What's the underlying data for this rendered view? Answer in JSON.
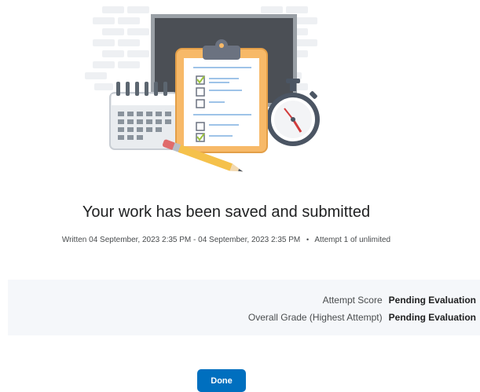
{
  "submission": {
    "title": "Your work has been saved and submitted",
    "written_label": "Written",
    "written_range": "04 September, 2023 2:35 PM - 04 September, 2023 2:35 PM",
    "separator": "•",
    "attempt_text": "Attempt 1 of unlimited"
  },
  "scores": {
    "attempt_score_label": "Attempt Score",
    "attempt_score_value": "Pending Evaluation",
    "overall_grade_label": "Overall Grade (Highest Attempt)",
    "overall_grade_value": "Pending Evaluation"
  },
  "actions": {
    "done_label": "Done"
  },
  "colors": {
    "primary": "#006fbf",
    "panel_bg": "#f5f7fa",
    "clipboard": "#f7b968",
    "board": "#4b4f55"
  },
  "illustration": {
    "icons": [
      "brick-wall",
      "chalkboard",
      "clipboard-checklist-icon",
      "calendar-icon",
      "stopwatch-icon",
      "pencil-icon"
    ]
  }
}
